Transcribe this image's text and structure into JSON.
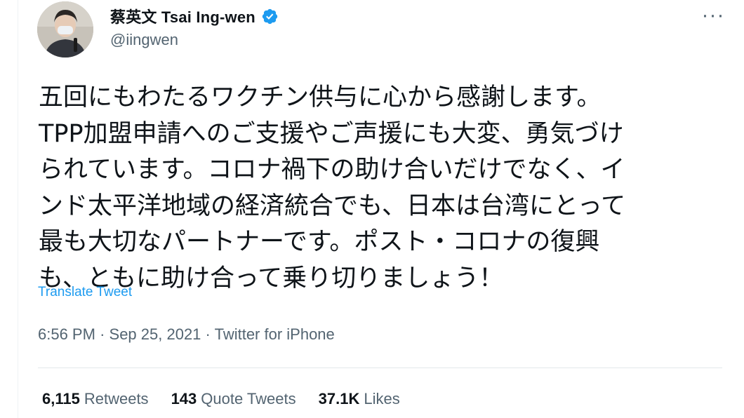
{
  "author": {
    "display_name": "蔡英文 Tsai Ing-wen",
    "handle": "@iingwen",
    "verified_icon": "verified-badge",
    "avatar_icon": "profile-photo"
  },
  "more_icon": "more-options-icon",
  "tweet": {
    "lines": [
      "五回にもわたるワクチン供与に心から感謝します。",
      "TPP加盟申請へのご支援やご声援にも大変、勇気づけ",
      "られています。コロナ禍下の助け合いだけでなく、イ",
      "ンド太平洋地域の経済統合でも、日本は台湾にとって",
      "最も大切なパートナーです。ポスト・コロナの復興",
      "も、ともに助け合って乗り切りましょう！"
    ],
    "translate_label": "Translate Tweet",
    "time": "6:56 PM",
    "date": "Sep 25, 2021",
    "source": "Twitter for iPhone"
  },
  "stats": {
    "retweets": {
      "count": "6,115",
      "label": "Retweets"
    },
    "quote_tweets": {
      "count": "143",
      "label": "Quote Tweets"
    },
    "likes": {
      "count": "37.1K",
      "label": "Likes"
    }
  },
  "colors": {
    "accent": "#1d9bf0",
    "text_primary": "#0f1419",
    "text_secondary": "#536471"
  }
}
